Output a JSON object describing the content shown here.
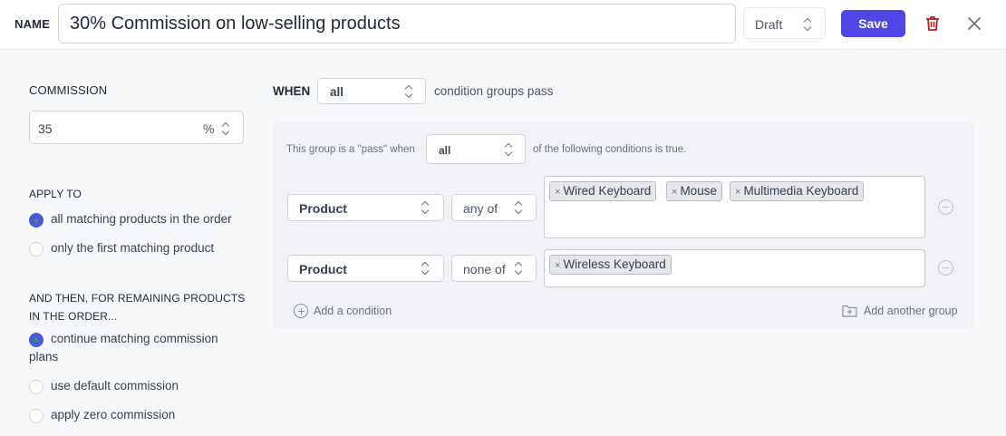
{
  "header": {
    "name_label": "NAME",
    "name_value": "30% Commission on low-selling products",
    "status_value": "Draft",
    "save_label": "Save",
    "delete_icon": "trash-icon",
    "close_icon": "close-icon"
  },
  "commission": {
    "label": "COMMISSION",
    "value": "35",
    "unit": "%"
  },
  "apply_to": {
    "label": "APPLY TO",
    "options": [
      {
        "label": "all matching products in the order",
        "selected": true
      },
      {
        "label": "only the first matching product",
        "selected": false
      }
    ]
  },
  "and_then": {
    "label_line1": "AND THEN, FOR REMAINING PRODUCTS",
    "label_line2": "IN THE ORDER...",
    "options": [
      {
        "label_line1": "continue matching commission",
        "label_line2": "plans",
        "selected": true
      },
      {
        "label": "use default commission",
        "selected": false
      },
      {
        "label": "apply zero commission",
        "selected": false
      }
    ]
  },
  "when": {
    "label": "WHEN",
    "value": "all",
    "suffix": "condition groups pass"
  },
  "group": {
    "prefix": "This group is a \"pass\" when",
    "value": "all",
    "suffix": "of the following conditions is true.",
    "conditions": [
      {
        "field": "Product",
        "operator": "any of",
        "tags": [
          "Wired Keyboard",
          "Mouse",
          "Multimedia Keyboard"
        ]
      },
      {
        "field": "Product",
        "operator": "none of",
        "tags": [
          "Wireless Keyboard"
        ]
      }
    ],
    "add_condition_label": "Add a condition",
    "add_group_label": "Add another group"
  },
  "colors": {
    "accent": "#5046e5",
    "delete": "#b91c1c",
    "radio_selected": "#4b5bd4"
  }
}
